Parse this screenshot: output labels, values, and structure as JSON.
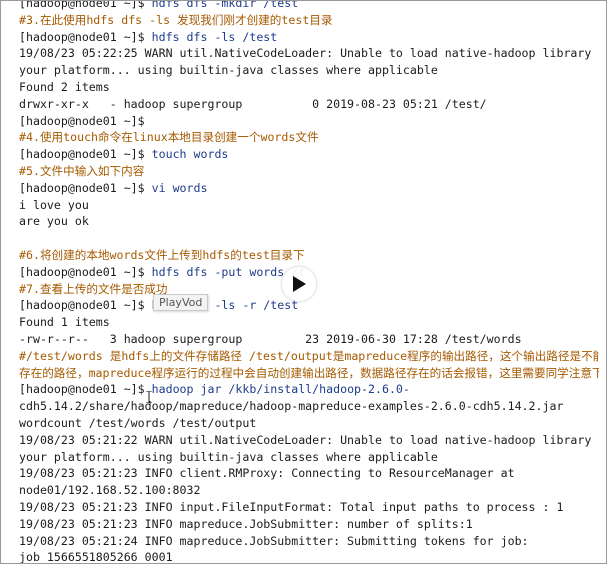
{
  "terminal": {
    "lines": [
      {
        "type": "cmd",
        "prompt": "[hadoop@node01 ~]$ ",
        "text": "hdfs dfs -mkdir /test"
      },
      {
        "type": "comment",
        "text": "#3.在此使用hdfs dfs -ls 发现我们刚才创建的test目录"
      },
      {
        "type": "cmd",
        "prompt": "[hadoop@node01 ~]$ ",
        "text": "hdfs dfs -ls /test"
      },
      {
        "type": "out",
        "text": "19/08/23 05:22:25 WARN util.NativeCodeLoader: Unable to load native-hadoop library for"
      },
      {
        "type": "out",
        "text": "your platform... using builtin-java classes where applicable"
      },
      {
        "type": "out",
        "text": "Found 2 items"
      },
      {
        "type": "out",
        "text": "drwxr-xr-x   - hadoop supergroup          0 2019-08-23 05:21 /test/"
      },
      {
        "type": "cmd",
        "prompt": "[hadoop@node01 ~]$ ",
        "text": ""
      },
      {
        "type": "comment",
        "text": "#4.使用touch命令在linux本地目录创建一个words文件"
      },
      {
        "type": "cmd",
        "prompt": "[hadoop@node01 ~]$ ",
        "text": "touch words"
      },
      {
        "type": "comment",
        "text": "#5.文件中输入如下内容"
      },
      {
        "type": "cmd",
        "prompt": "[hadoop@node01 ~]$ ",
        "text": "vi words"
      },
      {
        "type": "out",
        "text": "i love you"
      },
      {
        "type": "out",
        "text": "are you ok"
      },
      {
        "type": "blank",
        "text": ""
      },
      {
        "type": "comment",
        "text": "#6.将创建的本地words文件上传到hdfs的test目录下"
      },
      {
        "type": "cmd",
        "prompt": "[hadoop@node01 ~]$ ",
        "text": "hdfs dfs -put words /t"
      },
      {
        "type": "comment",
        "text": "#7.查看上传的文件是否成功"
      },
      {
        "type": "cmd",
        "prompt": "[hadoop@node01 ~]$ ",
        "text": "hdfs dfs -ls -r /test"
      },
      {
        "type": "out",
        "text": "Found 1 items"
      },
      {
        "type": "out",
        "text": "-rw-r--r--   3 hadoop supergroup         23 2019-06-30 17:28 /test/words"
      },
      {
        "type": "comment",
        "text": "#/test/words 是hdfs上的文件存储路径 /test/output是mapreduce程序的输出路径，这个输出路径是不能已经"
      },
      {
        "type": "comment",
        "text": "存在的路径，mapreduce程序运行的过程中会自动创建输出路径，数据路径存在的话会报错，这里需要同学注意下."
      },
      {
        "type": "cmd",
        "prompt": "[hadoop@node01 ~]$ ",
        "text": "hadoop jar /kkb/install/hadoop-2.6.0-"
      },
      {
        "type": "out",
        "text": "cdh5.14.2/share/hadoop/mapreduce/hadoop-mapreduce-examples-2.6.0-cdh5.14.2.jar"
      },
      {
        "type": "out",
        "text": "wordcount /test/words /test/output"
      },
      {
        "type": "out",
        "text": "19/08/23 05:21:22 WARN util.NativeCodeLoader: Unable to load native-hadoop library for"
      },
      {
        "type": "out",
        "text": "your platform... using builtin-java classes where applicable"
      },
      {
        "type": "out",
        "text": "19/08/23 05:21:23 INFO client.RMProxy: Connecting to ResourceManager at"
      },
      {
        "type": "out",
        "text": "node01/192.168.52.100:8032"
      },
      {
        "type": "out",
        "text": "19/08/23 05:21:23 INFO input.FileInputFormat: Total input paths to process : 1"
      },
      {
        "type": "out",
        "text": "19/08/23 05:21:23 INFO mapreduce.JobSubmitter: number of splits:1"
      },
      {
        "type": "out",
        "text": "19/08/23 05:21:24 INFO mapreduce.JobSubmitter: Submitting tokens for job:"
      },
      {
        "type": "out",
        "text": "job_1566551805266_0001"
      }
    ]
  },
  "overlay": {
    "play_icon": "play-icon",
    "tooltip": "PlayVod"
  },
  "colors": {
    "comment": "#a65a00",
    "command": "#1e3c8c",
    "text": "#1b1b1b"
  }
}
